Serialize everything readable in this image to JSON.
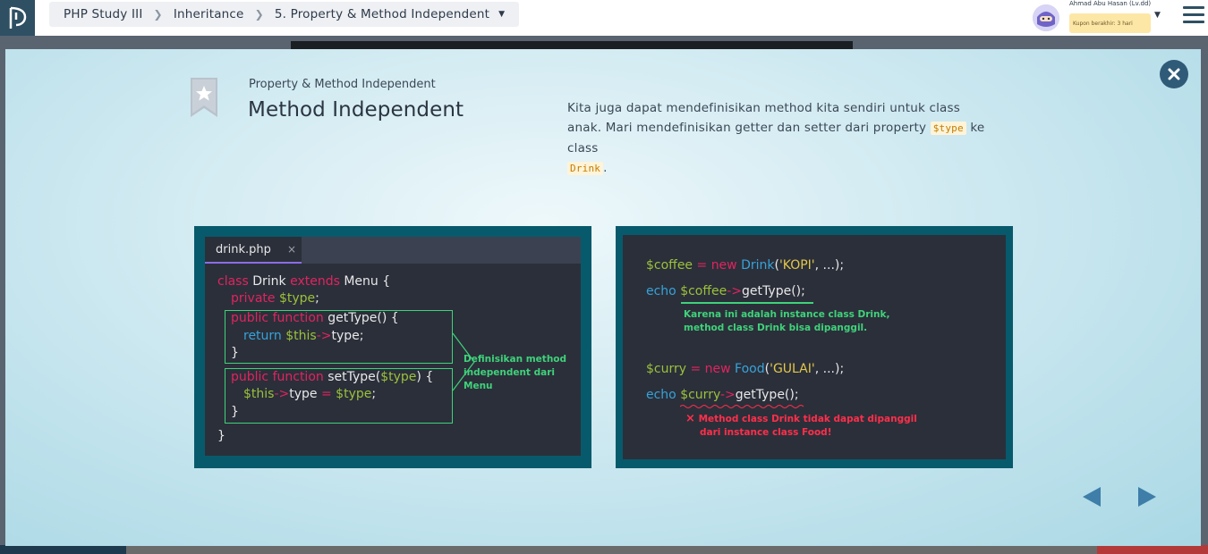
{
  "topbar": {
    "breadcrumb": [
      "PHP Study III",
      "Inheritance",
      "5. Property & Method Independent"
    ],
    "user_name": "Ahmad Abu Hasan (Lv.dd)",
    "coupon": "Kupon berakhir: 3 hari"
  },
  "lesson": {
    "subtitle": "Property & Method Independent",
    "title": "Method Independent",
    "desc_1": "Kita juga dapat mendefinisikan method kita sendiri untuk class anak. Mari mendefinisikan getter dan setter dari property",
    "desc_code_1": "$type",
    "desc_2": "ke class",
    "desc_code_2": "Drink",
    "desc_3": "."
  },
  "left_panel": {
    "tab_label": "drink.php",
    "tab_close": "×",
    "code": {
      "l1_kw1": "class",
      "l1_name": " Drink ",
      "l1_kw2": "extends",
      "l1_rest": " Menu {",
      "l2_kw": "private",
      "l2_var": " $type",
      "l2_rest": ";",
      "l3_kw": "public function",
      "l3_rest": " getType() {",
      "l4_kw": "return",
      "l4_var": " $this",
      "l4_arrow": "->",
      "l4_rest": "type;",
      "l5": "}",
      "l6_kw": "public function",
      "l6_rest1": " setType(",
      "l6_var": "$type",
      "l6_rest2": ") {",
      "l7_var": "$this",
      "l7_arrow": "->",
      "l7_rest1": "type ",
      "l7_eq": "=",
      "l7_var2": " $type",
      "l7_rest2": ";",
      "l8": "}",
      "l9": "}"
    },
    "note": [
      "Definisikan method",
      "independent dari Menu"
    ]
  },
  "right_panel": {
    "code": {
      "r1_var": "$coffee",
      "r1_eq": " = ",
      "r1_kw": "new",
      "r1_cls": " Drink",
      "r1_p1": "(",
      "r1_str": "'KOPI'",
      "r1_p2": ", ...);",
      "r2_echo": "echo",
      "r2_var": " $coffee",
      "r2_arrow": "->",
      "r2_rest": "getType();",
      "r3_var": "$curry",
      "r3_eq": " = ",
      "r3_kw": "new",
      "r3_cls": " Food",
      "r3_p1": "(",
      "r3_str": "'GULAI'",
      "r3_p2": ", ...);",
      "r4_echo": "echo",
      "r4_var": " $curry",
      "r4_arrow": "->",
      "r4_rest": "getType();"
    },
    "note_green": [
      "Karena ini adalah instance class Drink,",
      "method class Drink bisa dipanggil."
    ],
    "note_red": [
      "Method class Drink tidak dapat dipanggil",
      "dari instance class Food!"
    ],
    "note_red_mark": "×"
  },
  "colors": {
    "accent": "#2f5b78",
    "code_bg": "#2b2f3a",
    "frame": "#075a6b"
  }
}
